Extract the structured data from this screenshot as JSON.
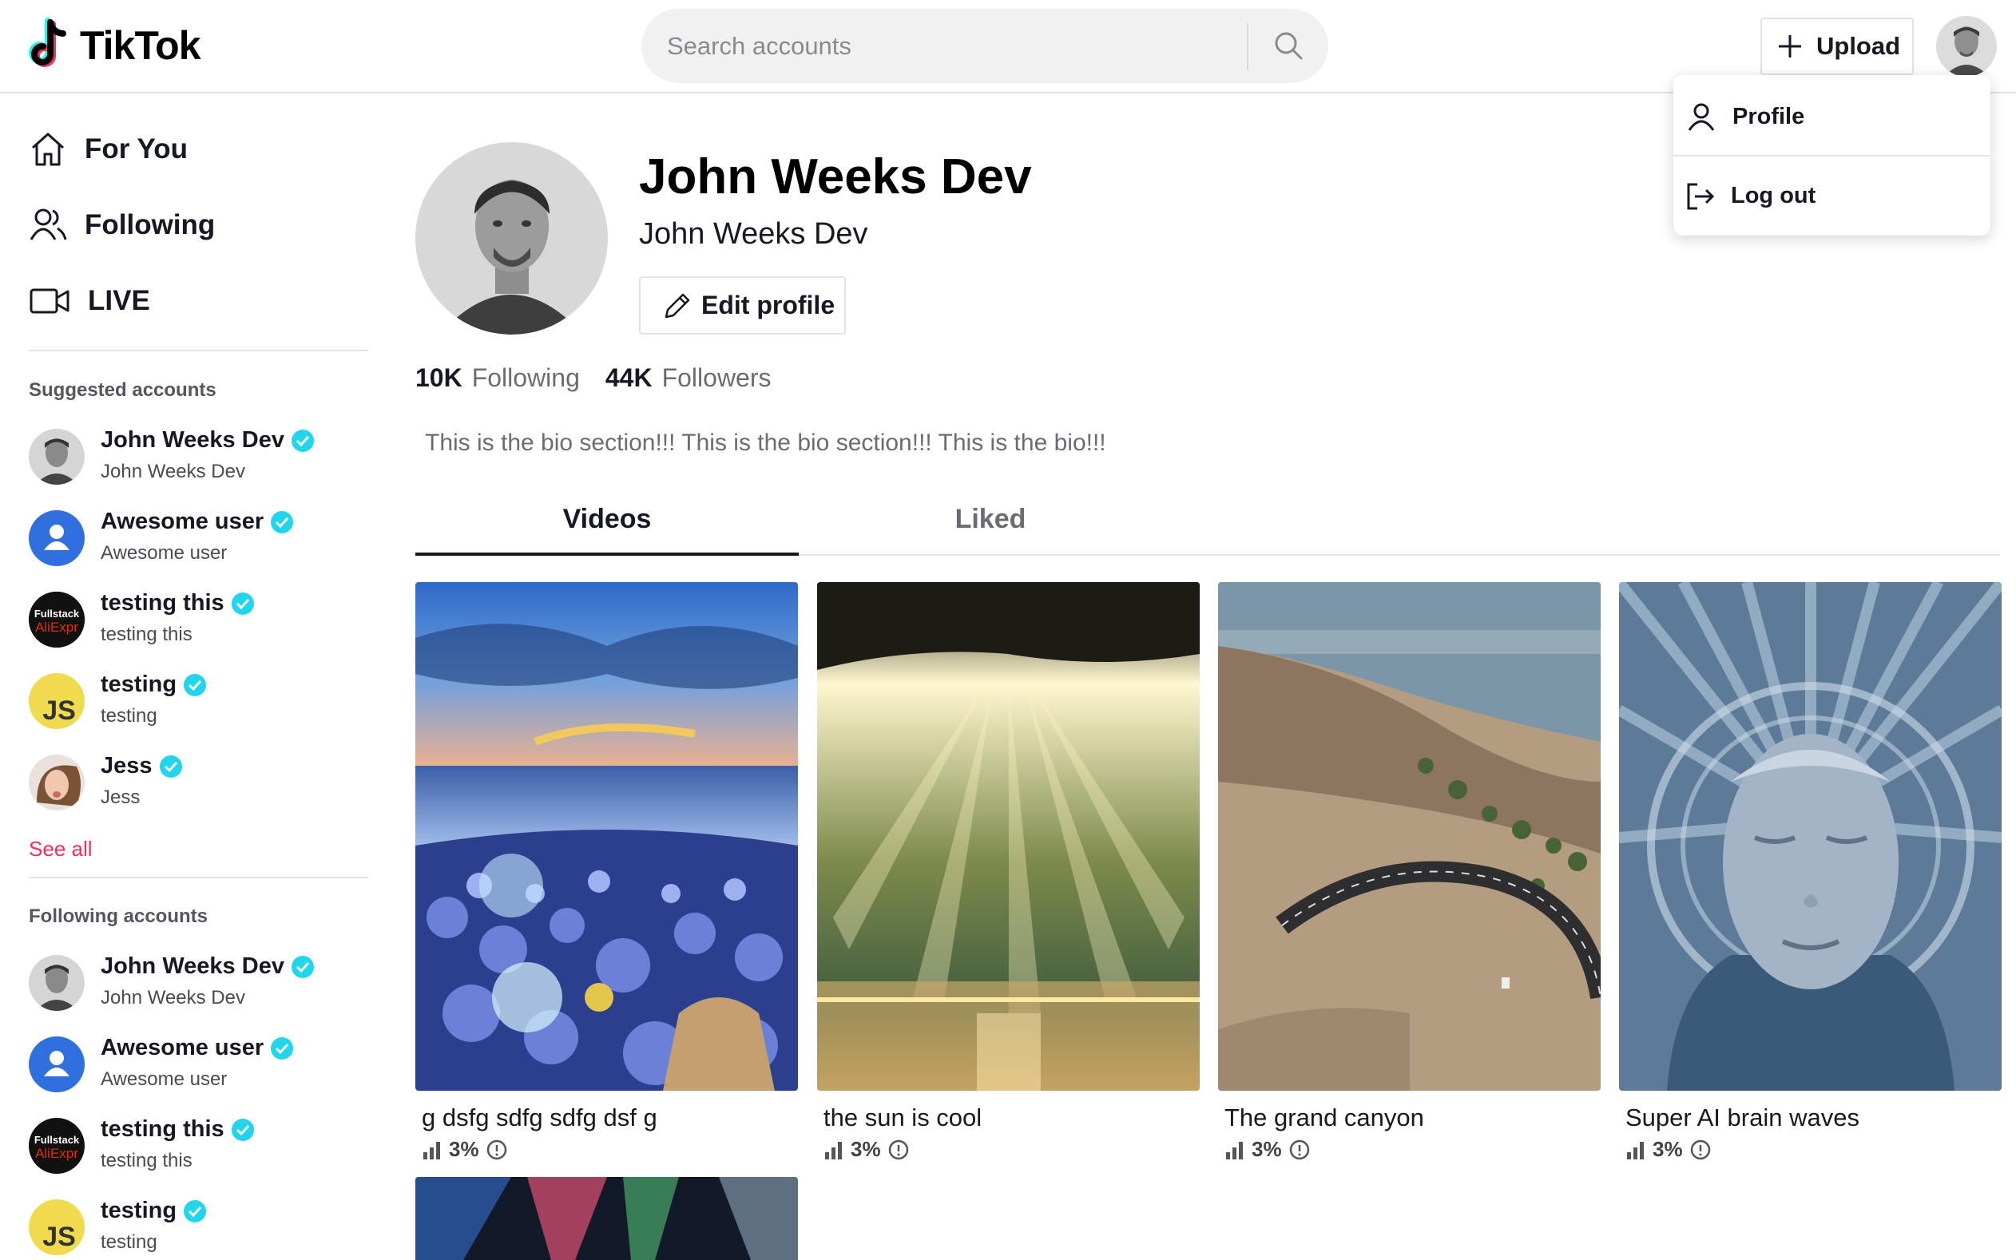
{
  "app": {
    "name": "TikTok"
  },
  "search": {
    "placeholder": "Search accounts"
  },
  "header": {
    "upload_label": "Upload"
  },
  "menu": {
    "profile_label": "Profile",
    "logout_label": "Log out"
  },
  "sidebar": {
    "nav": [
      {
        "label": "For You",
        "icon": "home-icon"
      },
      {
        "label": "Following",
        "icon": "users-icon"
      },
      {
        "label": "LIVE",
        "icon": "video-camera-icon"
      }
    ],
    "suggested_title": "Suggested accounts",
    "suggested": [
      {
        "name": "John Weeks Dev",
        "sub": "John Weeks Dev",
        "avatar": "photo-man"
      },
      {
        "name": "Awesome user",
        "sub": "Awesome user",
        "avatar": "default-blue"
      },
      {
        "name": "testing this",
        "sub": "testing this",
        "avatar": "fullstack-logo"
      },
      {
        "name": "testing",
        "sub": "testing",
        "avatar": "js-logo"
      },
      {
        "name": "Jess",
        "sub": "Jess",
        "avatar": "photo-woman"
      }
    ],
    "see_all": "See all",
    "following_title": "Following accounts",
    "following": [
      {
        "name": "John Weeks Dev",
        "sub": "John Weeks Dev",
        "avatar": "photo-man"
      },
      {
        "name": "Awesome user",
        "sub": "Awesome user",
        "avatar": "default-blue"
      },
      {
        "name": "testing this",
        "sub": "testing this",
        "avatar": "fullstack-logo"
      },
      {
        "name": "testing",
        "sub": "testing",
        "avatar": "js-logo"
      }
    ],
    "fullstack_logo_text": "Fullstack",
    "aliexpress_logo_text": "AliExpr",
    "js_logo_text": "JS"
  },
  "profile": {
    "name": "John Weeks Dev",
    "username": "John Weeks Dev",
    "edit_label": "Edit profile",
    "following_count": "10K",
    "following_label": "Following",
    "followers_count": "44K",
    "followers_label": "Followers",
    "bio": "This is the bio section!!! This is the bio section!!! This is the bio!!!"
  },
  "tabs": {
    "videos": "Videos",
    "liked": "Liked"
  },
  "videos": [
    {
      "title": "g dsfg sdfg sdfg dsf g",
      "stat": "3%"
    },
    {
      "title": "the sun is cool",
      "stat": "3%"
    },
    {
      "title": "The grand canyon",
      "stat": "3%"
    },
    {
      "title": "Super AI brain waves",
      "stat": "3%"
    }
  ],
  "colors": {
    "accent": "#fe2c55",
    "verified": "#20d5ec",
    "logo_cyan": "#25f4ee",
    "logo_red": "#fe2c55"
  }
}
